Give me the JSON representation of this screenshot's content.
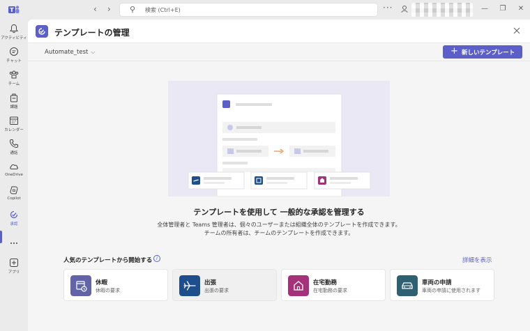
{
  "titlebar": {
    "search_placeholder": "検索 (Ctrl+E)",
    "more": "···"
  },
  "rail": {
    "items": [
      {
        "label": "アクティビティ",
        "icon": "bell-icon"
      },
      {
        "label": "チャット",
        "icon": "chat-icon"
      },
      {
        "label": "チーム",
        "icon": "teams-icon"
      },
      {
        "label": "課題",
        "icon": "assignments-icon"
      },
      {
        "label": "カレンダー",
        "icon": "calendar-icon"
      },
      {
        "label": "通話",
        "icon": "phone-icon"
      },
      {
        "label": "OneDrive",
        "icon": "cloud-icon"
      },
      {
        "label": "Copilot",
        "icon": "copilot-icon"
      },
      {
        "label": "承認",
        "icon": "approvals-icon",
        "active": true
      },
      {
        "label": "",
        "icon": "more-icon"
      },
      {
        "label": "アプリ",
        "icon": "apps-icon"
      }
    ]
  },
  "header": {
    "title": "テンプレートの管理"
  },
  "subbar": {
    "team": "Automate_test",
    "new_template_label": "新しいテンプレート"
  },
  "hero": {
    "title": "テンプレートを使用して 一般的な承認を管理する",
    "desc_line1": "全体管理者と Teams 管理者は、個々のユーザーまたは組織全体のテンプレートを作成できます。",
    "desc_line2": "チームの所有者は、チームのテンプレートを作成できます。"
  },
  "popular": {
    "title": "人気のテンプレートから開始する",
    "detail_link": "詳細を表示",
    "templates": [
      {
        "name": "休暇",
        "desc": "休暇の要求",
        "icon": "calendar-clock-icon",
        "color": "#6264a7"
      },
      {
        "name": "出張",
        "desc": "出張の要求",
        "icon": "airplane-icon",
        "color": "#1f4e8c"
      },
      {
        "name": "在宅勤務",
        "desc": "在宅勤務の要求",
        "icon": "home-icon",
        "color": "#a4327a"
      },
      {
        "name": "車両の申請",
        "desc": "車両の申請に使用されます",
        "icon": "car-icon",
        "color": "#2f6173"
      }
    ]
  },
  "colors": {
    "accent": "#5b5fc7",
    "illustration_bg": "#e9e8f4"
  }
}
